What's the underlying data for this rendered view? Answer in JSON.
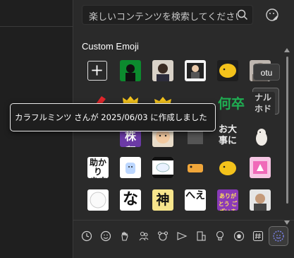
{
  "search": {
    "placeholder": "楽しいコンテンツを検索してください",
    "icon": "search-icon"
  },
  "section_title": "Custom Emoji",
  "hover_label": "otu",
  "tooltip": "カラフルミンツ さんが 2025/06/03 に作成しました",
  "emoji_text": {
    "r2c6": "何卒",
    "r2c7": "ナル ホド",
    "r3c1": "株留",
    "r3c6": "お大 事に",
    "r4c1": "助かり ます",
    "r5c2": "な",
    "r5c3": "神",
    "r5c4": "へえ",
    "r5c5": "ありがとう ございます"
  },
  "categories": [
    "clock-icon",
    "smile-icon",
    "hand-icon",
    "people-icon",
    "animal-icon",
    "food-icon",
    "building-icon",
    "lightbulb-icon",
    "ball-icon",
    "hash-icon",
    "custom-icon"
  ],
  "colors": {
    "panel": "#2a2a2a",
    "accent": "#7b83eb"
  }
}
